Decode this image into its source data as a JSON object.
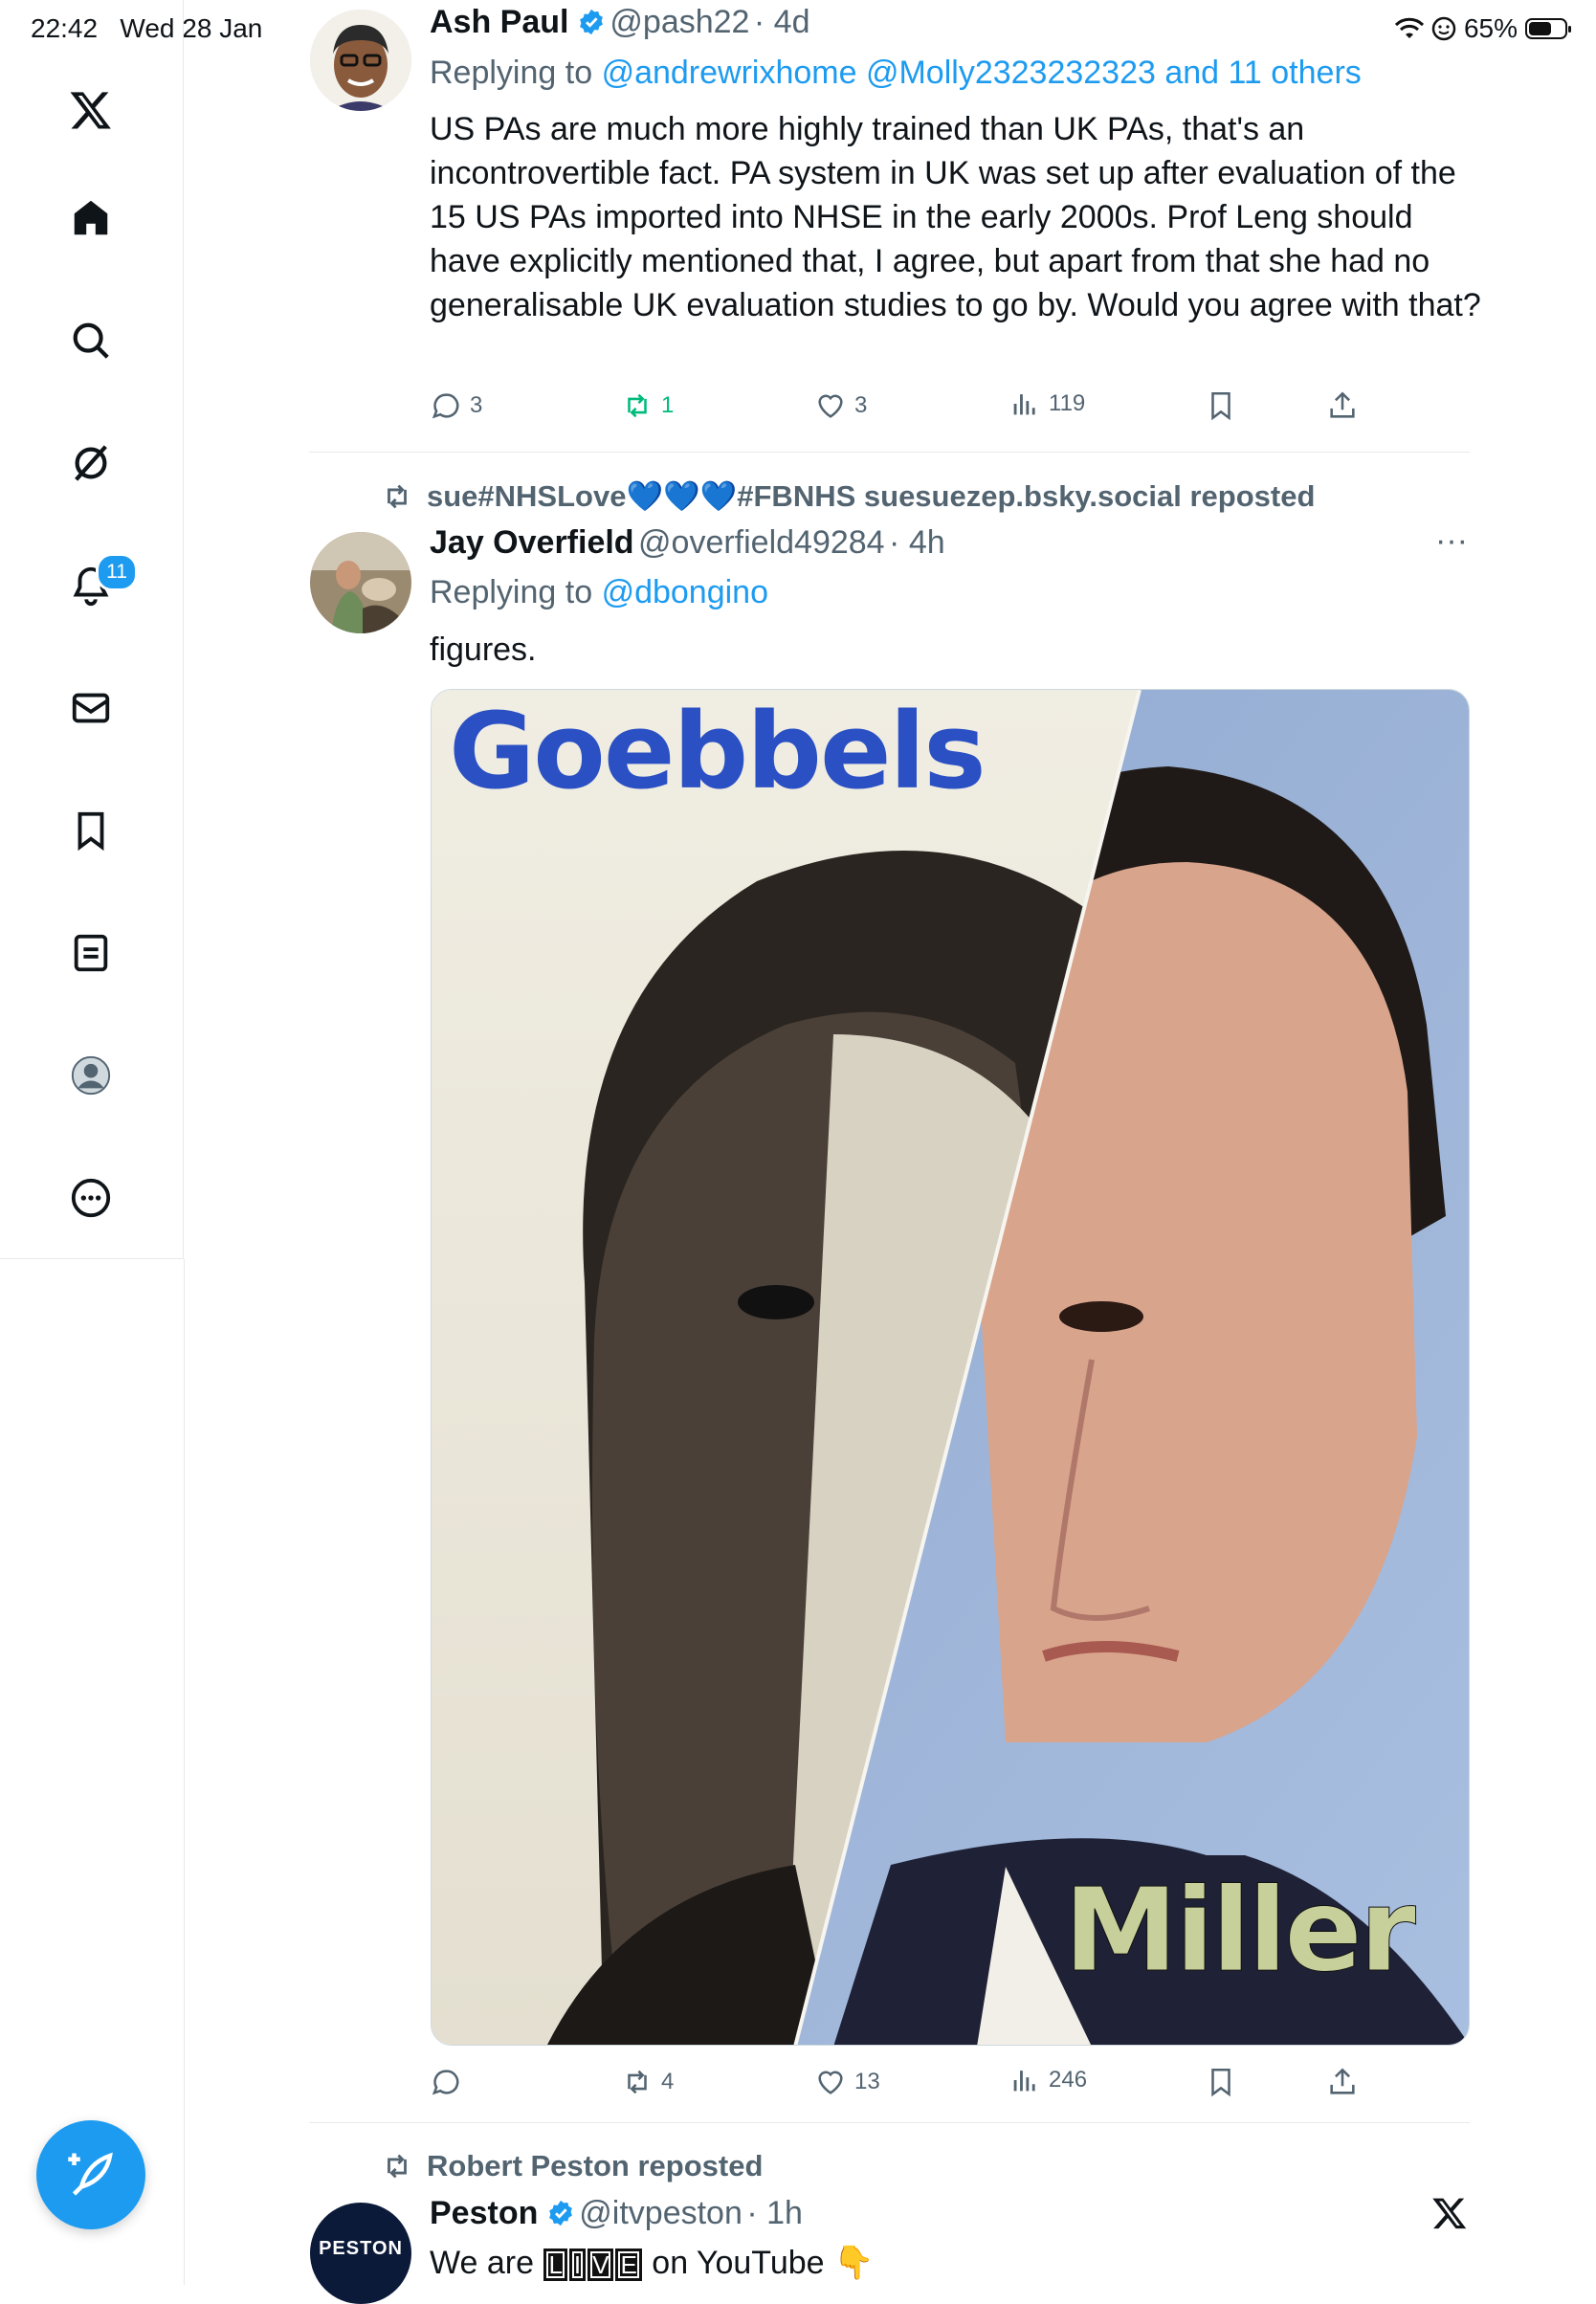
{
  "status_bar": {
    "time": "22:42",
    "date": "Wed 28 Jan",
    "battery": "65%",
    "battery_level": 0.65
  },
  "sidebar": {
    "notifications_badge": "11"
  },
  "colors": {
    "accent": "#1d9bf0",
    "retweet_active": "#00ba7c",
    "muted": "#536471"
  },
  "tweet1": {
    "name": "Ash Paul",
    "handle": "@pash22",
    "time": "· 4d",
    "replying_prefix": "Replying to",
    "replying_to": "@andrewrixhome @Molly2323232323 and 11 others",
    "text": "US PAs are much more highly trained than UK PAs, that's an incontrovertible fact. PA system in UK was set up after evaluation of the 15 US PAs imported into NHSE in the early 2000s. Prof Leng should have explicitly mentioned that, I agree, but apart from that she had no generalisable UK evaluation studies to go by. Would you agree with that?",
    "replies": "3",
    "retweets": "1",
    "likes": "3",
    "views": "119"
  },
  "tweet2": {
    "reposted_by": "sue#NHSLove💙💙💙#FBNHS suesuezep.bsky.social reposted",
    "name": "Jay Overfield",
    "handle": "@overfield49284",
    "time": "· 4h",
    "replying_prefix": "Replying to",
    "replying_to": "@dbongino",
    "text": "figures.",
    "image_top_label": "Goebbels",
    "image_bottom_label": "Miller",
    "replies": "",
    "retweets": "4",
    "likes": "13",
    "views": "246"
  },
  "tweet3": {
    "reposted_by": "Robert Peston reposted",
    "name": "Peston",
    "handle": "@itvpeston",
    "time": "· 1h",
    "avatar_text": "PESTON",
    "text_before": "We are",
    "live_letters": [
      "L",
      "I",
      "V",
      "E"
    ],
    "text_after": "on YouTube 👇"
  }
}
